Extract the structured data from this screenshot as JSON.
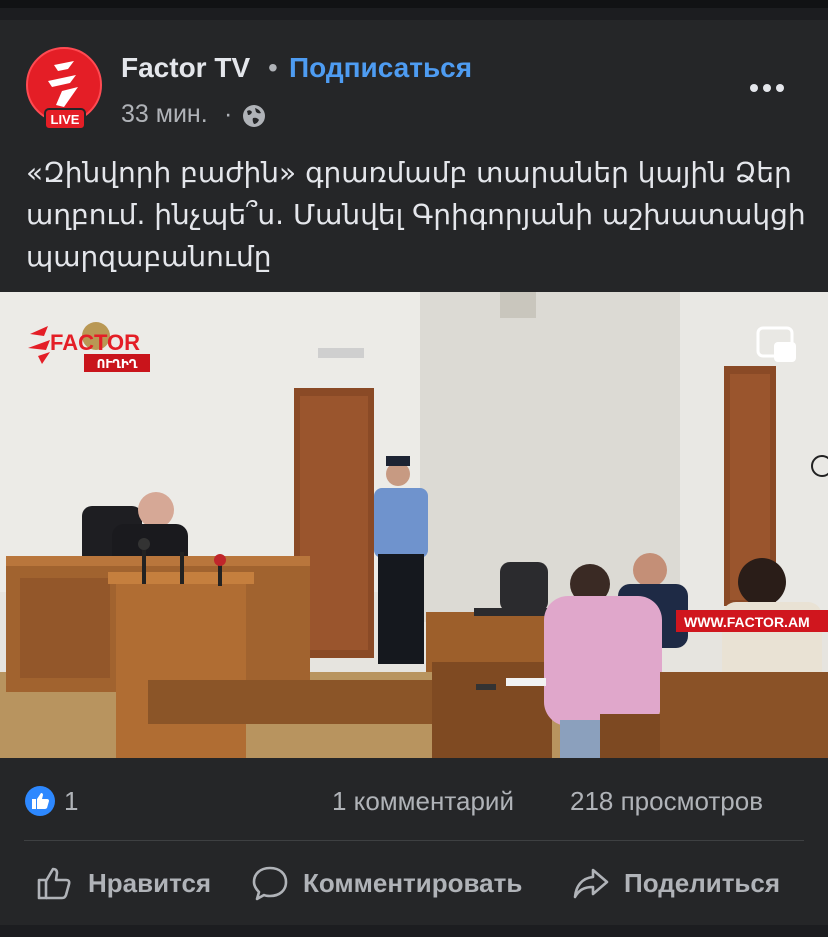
{
  "post": {
    "page_name": "Factor TV",
    "separator": "•",
    "subscribe_label": "Подписаться",
    "time": "33 мин.",
    "time_separator": "·",
    "avatar_badge": "LIVE",
    "text": "«Զինվորի բաժին» գրառմամբ տարաներ կային Ձեր աղբում. ինչպե՞ս. Մանվել Գրիգորյանի աշխատակցի պարզաբանումը"
  },
  "media": {
    "watermark_brand": "FACTOR",
    "watermark_sub": "ՈՒՂԻՂ",
    "watermark_url": "WWW.FACTOR.AM"
  },
  "stats": {
    "likes": "1",
    "comments": "1 комментарий",
    "views": "218 просмотров"
  },
  "actions": {
    "like": "Нравится",
    "comment": "Комментировать",
    "share": "Поделиться"
  },
  "colors": {
    "card_bg": "#252628",
    "link_blue": "#4e9cf2",
    "brand_red": "#e41e26",
    "muted_text": "#b0b3b8"
  },
  "icons": [
    "factor-logo-icon",
    "globe-icon",
    "more-options-icon",
    "picture-in-picture-icon",
    "like-badge-icon",
    "thumbs-up-icon",
    "comment-icon",
    "share-icon"
  ]
}
